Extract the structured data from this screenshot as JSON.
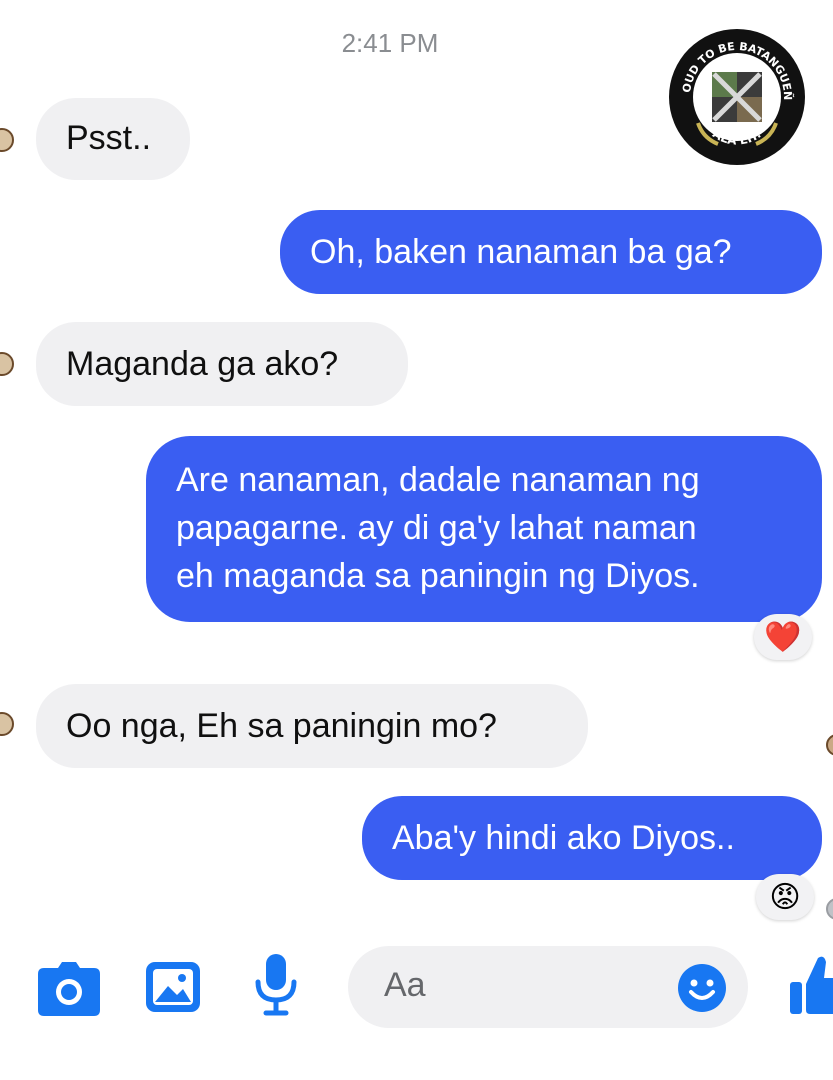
{
  "conversation": {
    "timestamp": "2:41 PM",
    "messages": [
      {
        "side": "in",
        "text": "Psst.."
      },
      {
        "side": "out",
        "text": "Oh, baken nanaman ba ga?"
      },
      {
        "side": "in",
        "text": "Maganda ga ako?"
      },
      {
        "side": "out",
        "lines": [
          "Are nanaman, dadale nanaman ng",
          "papagarne. ay di ga'y lahat naman",
          "eh maganda sa paningin ng Diyos."
        ],
        "reaction": "❤️"
      },
      {
        "side": "in",
        "text": "Oo nga, Eh sa paningin mo?"
      },
      {
        "side": "out",
        "text": "Aba'y hindi ako Diyos..",
        "reaction": "😡"
      }
    ]
  },
  "logo": {
    "top_text": "PROUD TO BE BATANGUEÑO",
    "bottom_text": "ALA EH!"
  },
  "composer": {
    "placeholder": "Aa",
    "icons": [
      "camera-icon",
      "image-icon",
      "microphone-icon",
      "emoji-icon",
      "thumbs-up-icon"
    ]
  },
  "colors": {
    "outgoing_bubble": "#3a5ef2",
    "incoming_bubble": "#f0f0f2",
    "accent": "#1877f2"
  }
}
